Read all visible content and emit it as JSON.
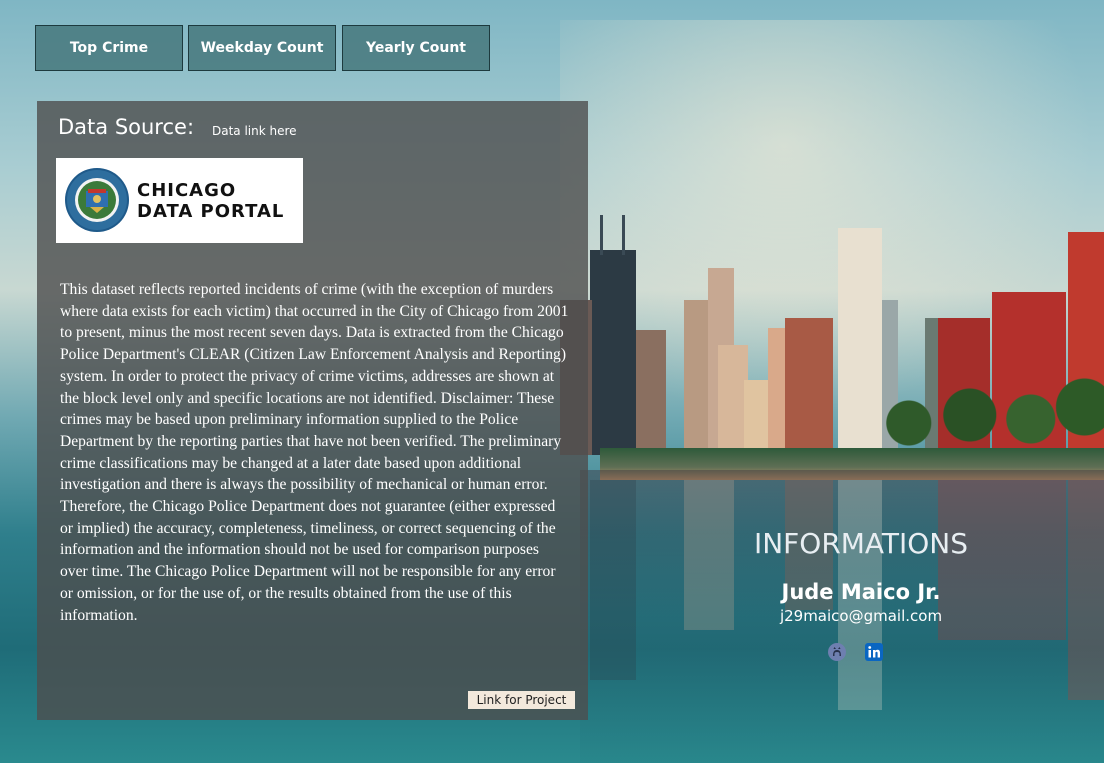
{
  "nav": {
    "tabs": [
      {
        "label": "Top Crime"
      },
      {
        "label": "Weekday Count"
      },
      {
        "label": "Yearly Count"
      }
    ]
  },
  "source_panel": {
    "heading": "Data Source:",
    "link_text": "Data link here",
    "logo": {
      "line1": "CHICAGO",
      "line2": "DATA PORTAL",
      "seal_text": "CITY OF CHICAGO · INCORPORATED 4th MARCH"
    },
    "description": "This dataset reflects reported incidents of crime (with the exception of murders where data exists for each victim) that occurred in the City of Chicago from 2001 to present, minus the most recent seven days. Data is extracted from the Chicago Police Department's CLEAR (Citizen Law Enforcement Analysis and Reporting) system. In order to protect the privacy of crime victims, addresses are shown at the block level only and specific locations are not identified. Disclaimer: These crimes may be based upon preliminary information supplied to the Police Department by the reporting parties that have not been verified. The preliminary crime classifications may be changed at a later date based upon additional investigation and there is always the possibility of mechanical or human error. Therefore, the Chicago Police Department does not guarantee (either expressed or implied) the accuracy, completeness, timeliness, or correct sequencing of the information and the information should not be used for comparison purposes over time. The Chicago Police Department will not be responsible for any error or omission, or for the use of, or the results obtained from the use of this information.",
    "project_link": "Link for Project"
  },
  "info": {
    "title": "INFORMATIONS",
    "name": "Jude Maico Jr.",
    "email": "j29maico@gmail.com",
    "icons": [
      "github-icon",
      "linkedin-icon"
    ]
  },
  "colors": {
    "tab_bg": "#46787d",
    "panel_bg": "#4e4e4e",
    "linkedin": "#0a66c2",
    "github": "#6e7fb0"
  }
}
